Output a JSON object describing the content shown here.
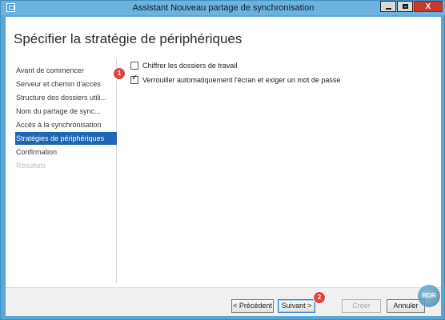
{
  "window": {
    "title": "Assistant Nouveau partage de synchronisation",
    "close_glyph": "X"
  },
  "page": {
    "title": "Spécifier la stratégie de périphériques"
  },
  "nav": {
    "items": [
      {
        "label": "Avant de commencer",
        "state": "normal"
      },
      {
        "label": "Serveur et chemin d'accès",
        "state": "normal"
      },
      {
        "label": "Structure des dossiers utili...",
        "state": "normal"
      },
      {
        "label": "Nom du partage de sync...",
        "state": "normal"
      },
      {
        "label": "Accès à la synchronisation",
        "state": "normal"
      },
      {
        "label": "Stratégies de périphériques",
        "state": "active"
      },
      {
        "label": "Confirmation",
        "state": "normal"
      },
      {
        "label": "Résultats",
        "state": "disabled"
      }
    ]
  },
  "options": {
    "encrypt": {
      "label": "Chiffrer les dossiers de travail",
      "checked": false
    },
    "autolock": {
      "label": "Verrouiller automatiquement l'écran et exiger un mot de passe",
      "checked": true
    }
  },
  "annotations": {
    "badge1": "1",
    "badge2": "2"
  },
  "footer": {
    "previous_label": "< Précédent",
    "next_label": "Suivant >",
    "create_label": "Créer",
    "cancel_label": "Annuler"
  },
  "watermark": {
    "text": "RDR"
  },
  "colors": {
    "accent": "#1f66b4",
    "frame": "#5aa6d6",
    "badge": "#e2433a"
  }
}
